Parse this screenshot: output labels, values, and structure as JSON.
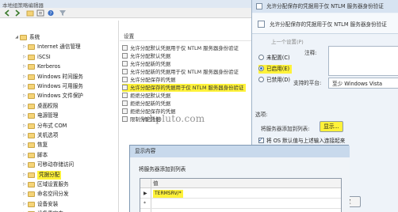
{
  "window": {
    "title": "本地组策略编辑器"
  },
  "tree": {
    "items": [
      {
        "label": "系统",
        "expanded": true
      },
      {
        "label": "Internet 通信管理",
        "expanded": false
      },
      {
        "label": "iSCSI",
        "expanded": false
      },
      {
        "label": "Kerberos",
        "expanded": false
      },
      {
        "label": "Windows 时间服务",
        "expanded": false
      },
      {
        "label": "Windows 可用服务",
        "expanded": false
      },
      {
        "label": "Windows 文件保护",
        "expanded": false
      },
      {
        "label": "桌面权限",
        "expanded": false
      },
      {
        "label": "电源管理",
        "expanded": false
      },
      {
        "label": "分布式 COM",
        "expanded": false
      },
      {
        "label": "关机选项",
        "expanded": false
      },
      {
        "label": "恢复",
        "expanded": false
      },
      {
        "label": "脚本",
        "expanded": false
      },
      {
        "label": "可移动存储访问",
        "expanded": false
      },
      {
        "label": "凭据分配",
        "expanded": false,
        "selected": true
      },
      {
        "label": "区域设置服务",
        "expanded": false
      },
      {
        "label": "命名空间分发",
        "expanded": false
      },
      {
        "label": "设备安装",
        "expanded": false
      },
      {
        "label": "设备重定向",
        "expanded": false
      }
    ]
  },
  "settings": {
    "header": "设置",
    "rows": [
      {
        "label": "允许分配默认凭据用于仅 NTLM 服务器身份验证",
        "highlighted": false
      },
      {
        "label": "允许分配默认凭据",
        "highlighted": false
      },
      {
        "label": "允许分配新的凭据",
        "highlighted": false
      },
      {
        "label": "允许分配新的凭据用于仅 NTLM 服务器身份验证",
        "highlighted": false
      },
      {
        "label": "允许分配保存的凭据",
        "highlighted": false
      },
      {
        "label": "允许分配保存的凭据用于仅 NTLM 服务器身份验证",
        "highlighted": true
      },
      {
        "label": "拒绝分配默认凭据",
        "highlighted": false
      },
      {
        "label": "拒绝分配新的凭据",
        "highlighted": false
      },
      {
        "label": "拒绝分配保存的凭据",
        "highlighted": false
      },
      {
        "label": "限制分配凭据",
        "highlighted": false
      }
    ]
  },
  "policy_dialog": {
    "title": "允许分配保存的凭据用于仅 NTLM 服务器身份验证",
    "heading": "允许分配保存的凭据用于仅 NTLM 服务器身份验证",
    "prev_button": "上一个设置(P)",
    "radios": [
      {
        "label": "未配置(C)",
        "checked": false
      },
      {
        "label": "已启用(E)",
        "checked": true
      },
      {
        "label": "已禁用(D)",
        "checked": false
      }
    ],
    "comment_label": "注释:",
    "supported_label": "支持的平台:",
    "supported_value": "至少 Windows Vista",
    "options_label": "选项:",
    "exceptions_label": "将服务器添加到列表:",
    "show_button": "显示...",
    "ntlm_checkbox": "将 OS 默认值与上述输入连接起来",
    "ok_button": "确定"
  },
  "show_dialog": {
    "title": "显示内容",
    "list_label": "将服务器添加到列表",
    "column_header": "值",
    "rows": [
      {
        "marker": "▶",
        "value": "TERMSRV/*",
        "highlighted": true
      },
      {
        "marker": "*",
        "value": "",
        "highlighted": false
      }
    ]
  },
  "watermark": "wbpluto.com",
  "colors": {
    "highlight": "#fff23a",
    "dialog_bg": "#eef3f9",
    "title_bar": "#d7e3f1"
  }
}
